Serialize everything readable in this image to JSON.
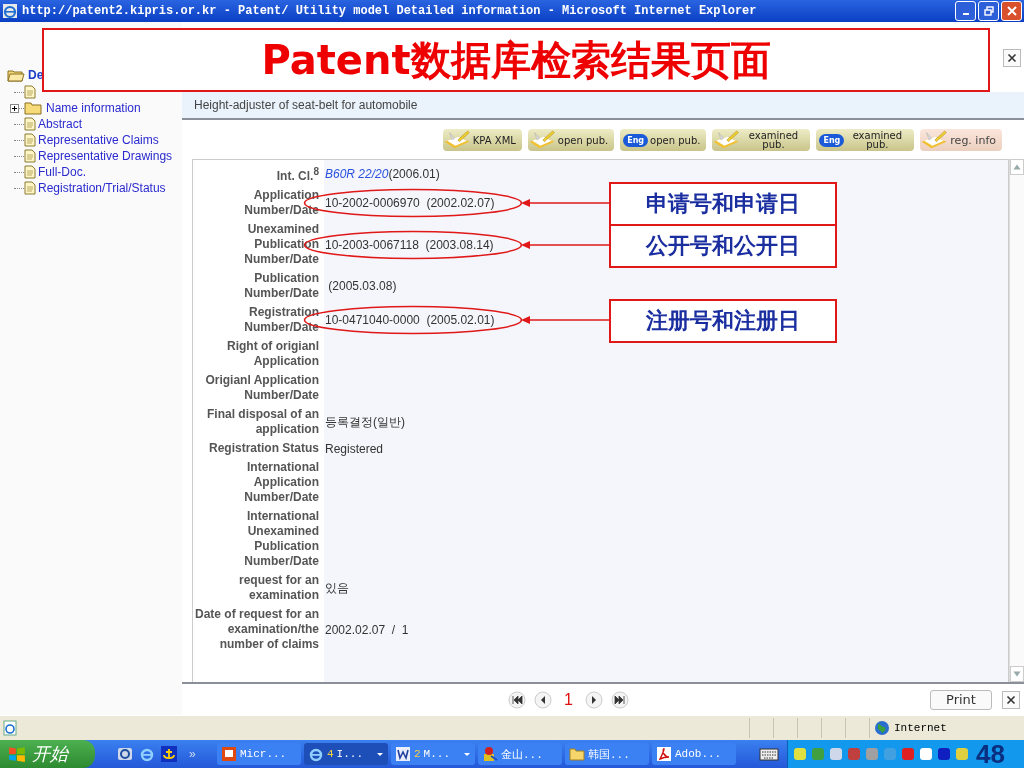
{
  "window": {
    "title": "http://patent2.kipris.or.kr - Patent/ Utility model Detailed information - Microsoft Internet Explorer"
  },
  "annotation_title": "Patent数据库检索结果页面",
  "sidebar": {
    "root": "De",
    "items": [
      {
        "kind": "document"
      },
      {
        "kind": "folder",
        "label": "Name information",
        "expanded": false
      },
      {
        "kind": "document",
        "label": "Abstract"
      },
      {
        "kind": "document",
        "label": "Representative Claims"
      },
      {
        "kind": "document",
        "label": "Representative Drawings"
      },
      {
        "kind": "document",
        "label": "Full-Doc."
      },
      {
        "kind": "document",
        "label": "Registration/Trial/Status"
      }
    ]
  },
  "subtitle": "Height-adjuster of seat-belt for automobile",
  "buttons": [
    {
      "label": "KPA XML",
      "kind": "doc",
      "selected": false
    },
    {
      "label": "open pub.",
      "kind": "doc",
      "selected": false
    },
    {
      "label": "open pub.",
      "kind": "eng",
      "badge": "Eng",
      "selected": false
    },
    {
      "label": "examined pub.",
      "kind": "doc",
      "selected": false
    },
    {
      "label": "examined pub.",
      "kind": "eng",
      "badge": "Eng",
      "selected": false
    },
    {
      "label": "reg. info",
      "kind": "doc",
      "selected": true
    }
  ],
  "rows": [
    {
      "label": "Int. Cl.$^{8}$",
      "link": "B60R 22/20",
      "value": "(2006.01)"
    },
    {
      "label": "Application\nNumber/Date",
      "value": "10-2002-0006970  (2002.02.07)",
      "callout": "申请号和申请日"
    },
    {
      "label": "Unexamined\nPublication\nNumber/Date",
      "value": "10-2003-0067118  (2003.08.14)",
      "callout": "公开号和公开日"
    },
    {
      "label": "Publication\nNumber/Date",
      "value": " (2005.03.08)"
    },
    {
      "label": "Registration\nNumber/Date",
      "value": "10-0471040-0000  (2005.02.01)",
      "callout": "注册号和注册日"
    },
    {
      "label": "Right of origianl\nApplication"
    },
    {
      "label": "Origianl Application\nNumber/Date"
    },
    {
      "label": "Final disposal of an\napplication",
      "value": "등록결정(일반)"
    },
    {
      "label": "Registration Status",
      "value": "Registered"
    },
    {
      "label": "International\nApplication\nNumber/Date"
    },
    {
      "label": "International\nUnexamined\nPublication\nNumber/Date"
    },
    {
      "label": "request for an\nexamination",
      "value": "있음"
    },
    {
      "label": "Date of request for an\nexamination/the\nnumber of claims",
      "value": "2002.02.07  /  1"
    }
  ],
  "pager": {
    "pages": [
      {
        "label": "1",
        "selected": true
      }
    ]
  },
  "print_button": "Print",
  "status": {
    "zone": "Internet"
  },
  "taskbar": {
    "start": "开始",
    "more": "»",
    "tasks": [
      {
        "kind": "powerpoint",
        "label": "Micr...",
        "selected": false,
        "dropdown": false
      },
      {
        "kind": "ie",
        "count": "4",
        "label": "I...",
        "selected": true,
        "dropdown": true
      },
      {
        "kind": "word",
        "count": "2",
        "label": "M...",
        "selected": false,
        "dropdown": true
      },
      {
        "kind": "app",
        "label": "金山...",
        "selected": false,
        "dropdown": false
      },
      {
        "kind": "folder",
        "label": "韩国...",
        "selected": false,
        "dropdown": false
      },
      {
        "kind": "acrobat",
        "label": "Adob...",
        "selected": false,
        "dropdown": false
      }
    ]
  },
  "slide_number": "48"
}
